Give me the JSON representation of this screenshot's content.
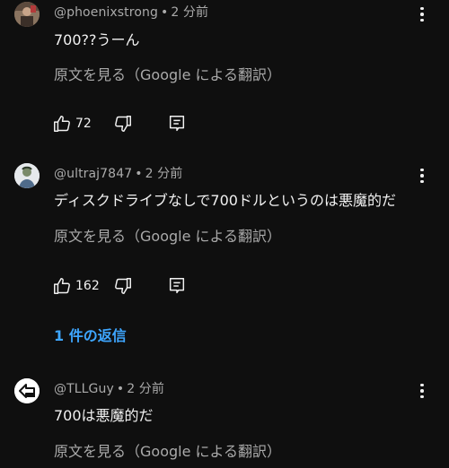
{
  "comments": [
    {
      "author": "@phoenixstrong",
      "separator": "•",
      "time": "2 分前",
      "text": "700??うーん",
      "translate_label": "原文を見る（Google による翻訳）",
      "likes": "72",
      "like_icon": "thumbs-up-icon",
      "dislike_icon": "thumbs-down-icon",
      "reply_icon": "reply-icon",
      "menu_icon": "more-vert-icon"
    },
    {
      "author": "@ultraj7847",
      "separator": "•",
      "time": "2 分前",
      "text": "ディスクドライブなしで700ドルというのは悪魔的だ",
      "translate_label": "原文を見る（Google による翻訳）",
      "likes": "162",
      "like_icon": "thumbs-up-icon",
      "dislike_icon": "thumbs-down-icon",
      "reply_icon": "reply-icon",
      "menu_icon": "more-vert-icon",
      "replies_label": "1 件の返信"
    },
    {
      "author": "@TLLGuy",
      "separator": "•",
      "time": "2 分前",
      "text": "700は悪魔的だ",
      "translate_label": "原文を見る（Google による翻訳）",
      "menu_icon": "more-vert-icon"
    }
  ],
  "colors": {
    "background": "#0f0f0f",
    "primary_text": "#f1f1f1",
    "secondary_text": "#aaaaaa",
    "link": "#3ea6ff"
  }
}
